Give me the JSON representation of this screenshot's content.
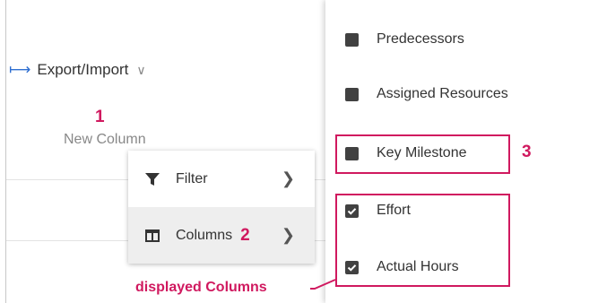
{
  "toolbar": {
    "export_import_label": "Export/Import"
  },
  "grid": {
    "new_column_label": "New Column"
  },
  "annotations": {
    "step1": "1",
    "step2": "2",
    "step3": "3",
    "displayed_columns": "displayed Columns"
  },
  "column_menu": {
    "items": [
      {
        "label": "Filter",
        "icon": "filter-icon"
      },
      {
        "label": "Columns",
        "icon": "columns-icon"
      }
    ]
  },
  "columns_dropdown": {
    "items": [
      {
        "label": "Predecessors",
        "checked": false
      },
      {
        "label": "Assigned Resources",
        "checked": false
      },
      {
        "label": "Key Milestone",
        "checked": false
      },
      {
        "label": "Effort",
        "checked": true
      },
      {
        "label": "Actual Hours",
        "checked": true
      }
    ]
  },
  "colors": {
    "accent": "#d0195f",
    "link": "#2f6fd1"
  }
}
